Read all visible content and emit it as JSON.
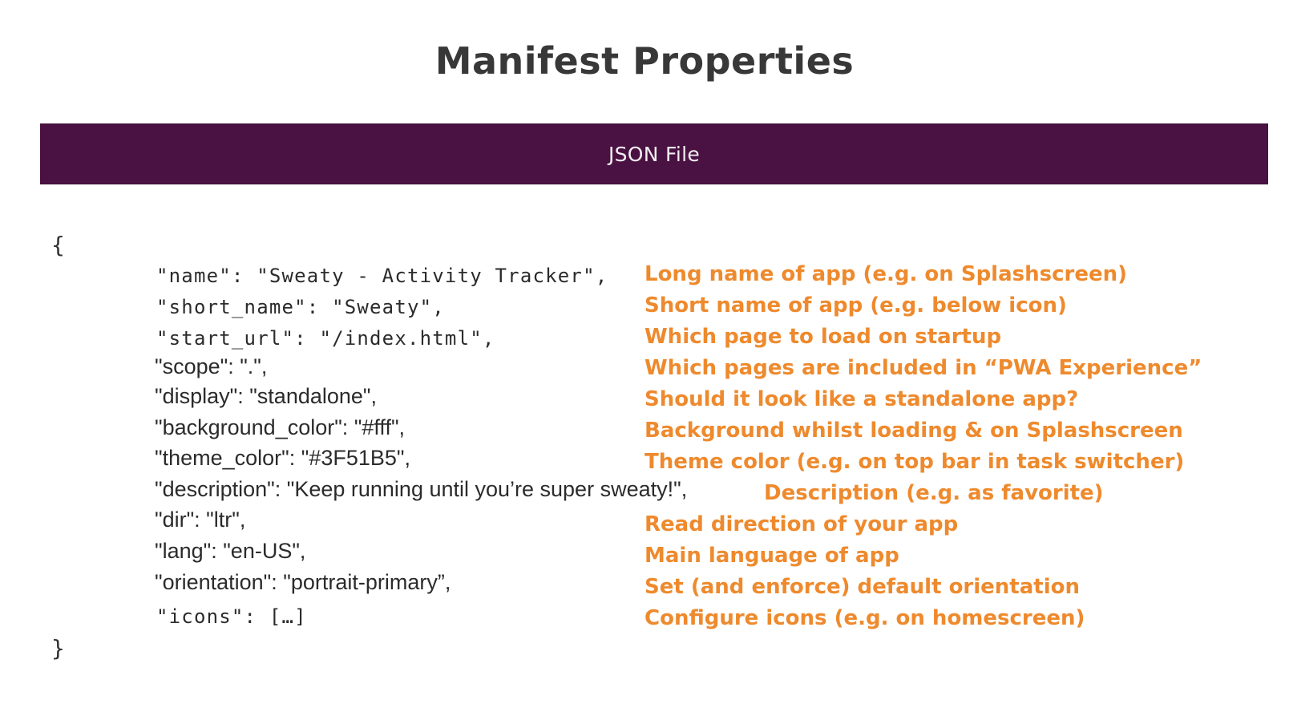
{
  "title": "Manifest Properties",
  "banner": {
    "label": "JSON File"
  },
  "code": {
    "open_brace": "{",
    "close_brace": "}",
    "lines": [
      "\"name\": \"Sweaty - Activity Tracker\",",
      "\"short_name\": \"Sweaty\",",
      "\"start_url\": \"/index.html\",",
      "\"scope\": \".\",",
      "\"display\": \"standalone\",",
      "\"background_color\": \"#fff\",",
      "\"theme_color\": \"#3F51B5\",",
      "\"description\": \"Keep running until you’re super sweaty!\",",
      "\"dir\": \"ltr\",",
      "\"lang\": \"en-US\",",
      "\"orientation\": \"portrait-primary”,",
      "\"icons\": […]"
    ]
  },
  "notes": [
    "Long name of app (e.g. on Splashscreen)",
    "Short name of app (e.g. below icon)",
    "Which page to load on startup",
    "Which pages are included in “PWA Experience”",
    "Should it look like a standalone app?",
    "Background whilst loading & on Splashscreen",
    "Theme color (e.g. on top bar in task switcher)",
    "Description (e.g. as favorite)",
    "Read direction of your app",
    "Main language of app",
    "Set (and enforce) default orientation",
    "Configure icons (e.g. on homescreen)"
  ],
  "colors": {
    "banner": "#4a1242",
    "note": "#ee8a2d",
    "title": "#383838"
  }
}
